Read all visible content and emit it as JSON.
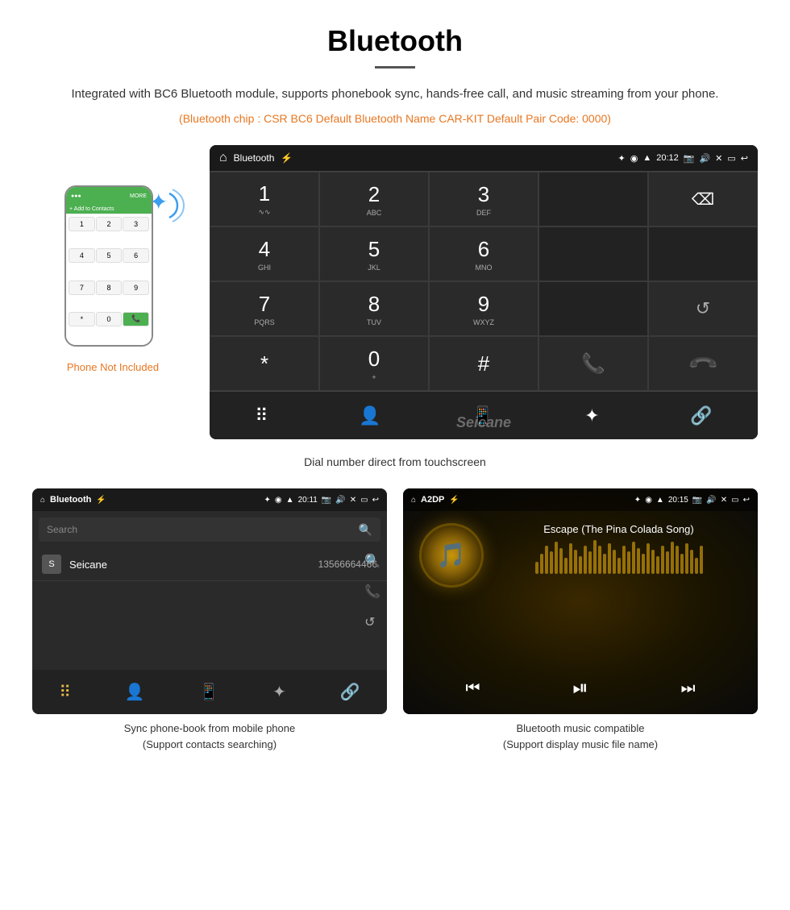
{
  "page": {
    "title": "Bluetooth",
    "divider": true,
    "description": "Integrated with BC6 Bluetooth module, supports phonebook sync, hands-free call, and music streaming from your phone.",
    "specs": "(Bluetooth chip : CSR BC6    Default Bluetooth Name CAR-KIT    Default Pair Code: 0000)",
    "main_caption": "Dial number direct from touchscreen",
    "phone_not_included": "Phone Not Included",
    "bottom_left_caption": "Sync phone-book from mobile phone\n(Support contacts searching)",
    "bottom_right_caption": "Bluetooth music compatible\n(Support display music file name)"
  },
  "dial_screen": {
    "status": {
      "title": "Bluetooth",
      "time": "20:12"
    },
    "keys": [
      {
        "num": "1",
        "letters": "⌄⌄"
      },
      {
        "num": "2",
        "letters": "ABC"
      },
      {
        "num": "3",
        "letters": "DEF"
      },
      {
        "num": "",
        "letters": ""
      },
      {
        "num": "⌫",
        "letters": ""
      }
    ],
    "row2": [
      {
        "num": "4",
        "letters": "GHI"
      },
      {
        "num": "5",
        "letters": "JKL"
      },
      {
        "num": "6",
        "letters": "MNO"
      },
      {
        "num": "",
        "letters": ""
      },
      {
        "num": "",
        "letters": ""
      }
    ],
    "row3": [
      {
        "num": "7",
        "letters": "PQRS"
      },
      {
        "num": "8",
        "letters": "TUV"
      },
      {
        "num": "9",
        "letters": "WXYZ"
      },
      {
        "num": "",
        "letters": ""
      },
      {
        "num": "↺",
        "letters": ""
      }
    ],
    "row4": [
      {
        "num": "*",
        "letters": ""
      },
      {
        "num": "0",
        "letters": "+"
      },
      {
        "num": "#",
        "letters": ""
      },
      {
        "num": "📞green",
        "letters": ""
      },
      {
        "num": "📞red",
        "letters": ""
      }
    ]
  },
  "phonebook_screen": {
    "status": {
      "title": "Bluetooth",
      "time": "20:11"
    },
    "search_placeholder": "Search",
    "contacts": [
      {
        "initial": "S",
        "name": "Seicane",
        "number": "13566664466"
      }
    ]
  },
  "music_screen": {
    "status": {
      "title": "A2DP",
      "time": "20:15"
    },
    "song_title": "Escape (The Pina Colada Song)",
    "eq_bars": [
      15,
      25,
      35,
      28,
      40,
      32,
      20,
      38,
      30,
      22,
      35,
      28,
      42,
      35,
      25,
      38,
      30,
      20,
      35,
      28,
      40,
      32,
      25,
      38,
      30,
      22,
      35,
      28,
      40,
      35,
      25,
      38,
      30,
      20,
      35
    ]
  }
}
